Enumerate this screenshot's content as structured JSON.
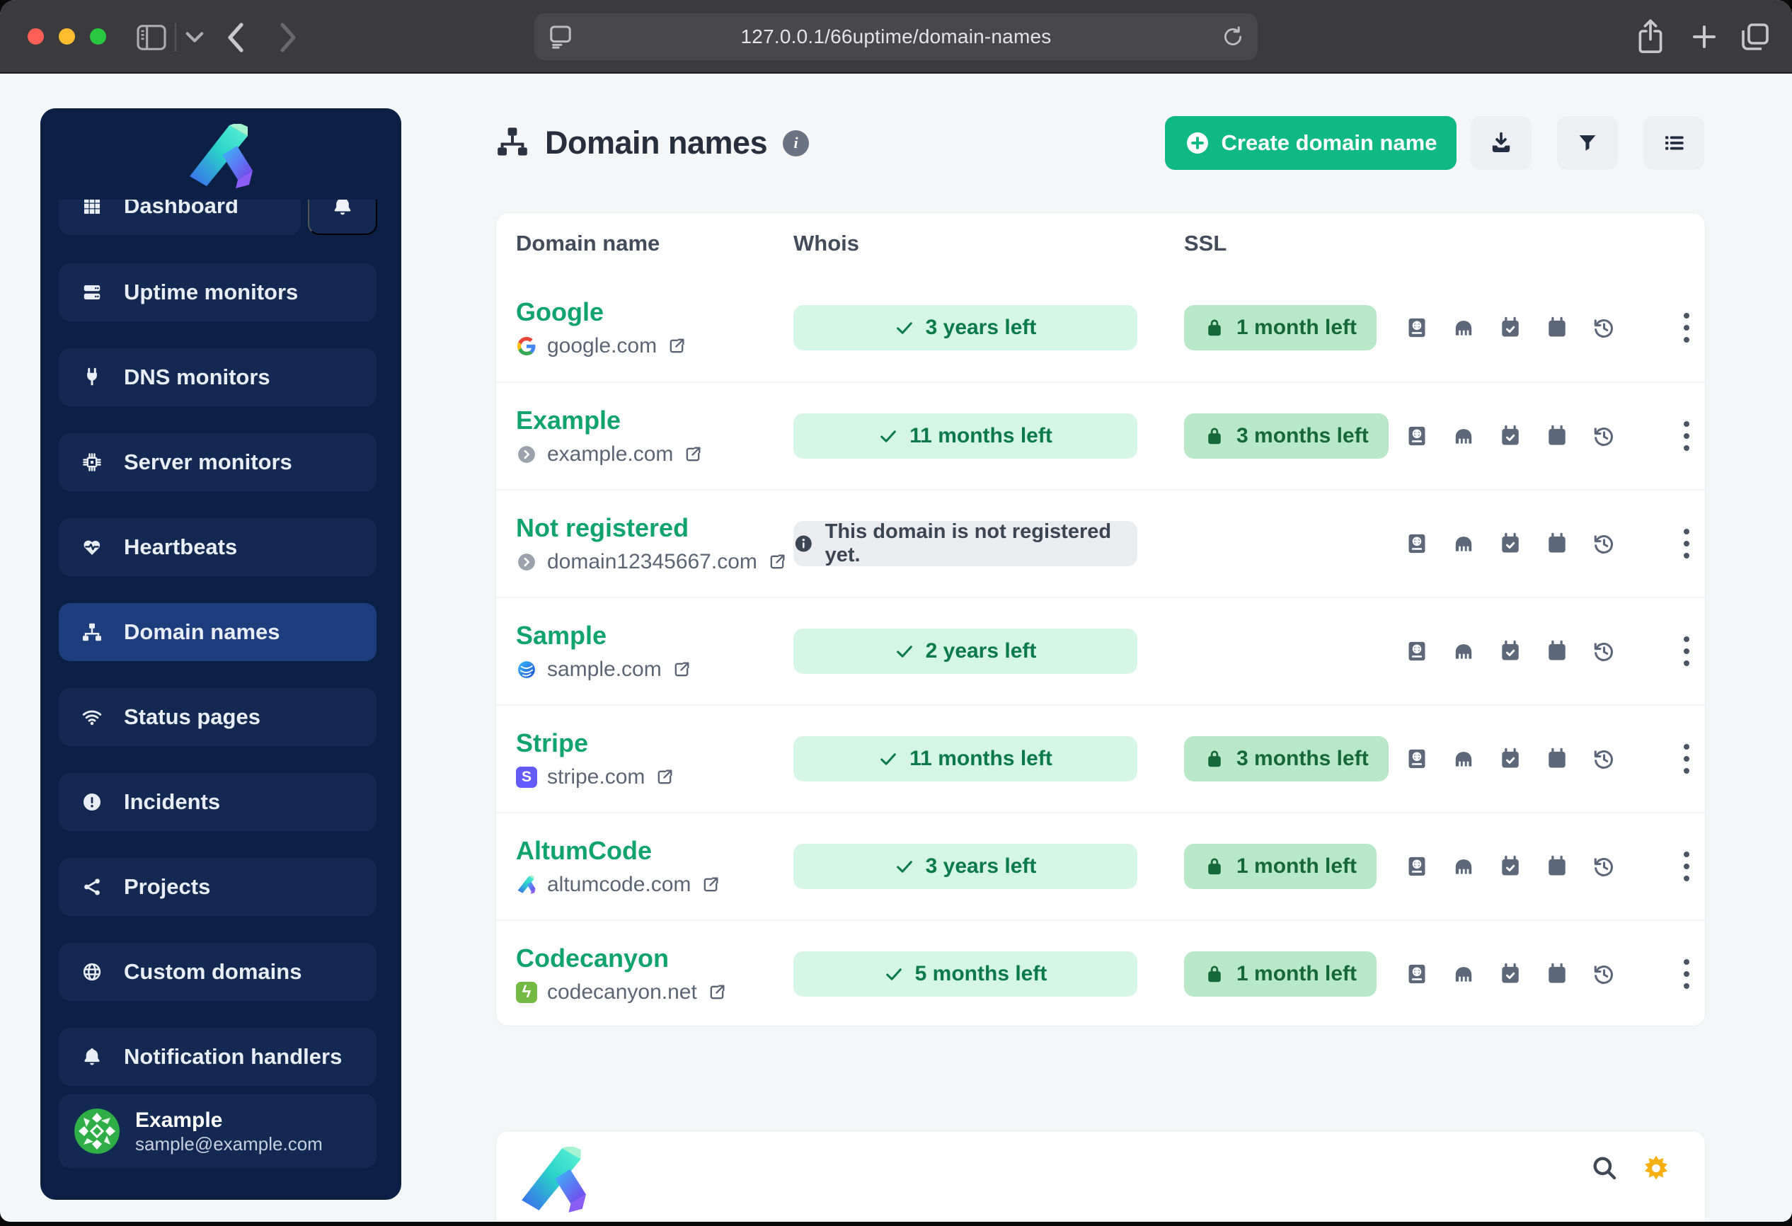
{
  "browser": {
    "url": "127.0.0.1/66uptime/domain-names"
  },
  "sidebar": {
    "items": [
      {
        "label": "Dashboard"
      },
      {
        "label": "Uptime monitors"
      },
      {
        "label": "DNS monitors"
      },
      {
        "label": "Server monitors"
      },
      {
        "label": "Heartbeats"
      },
      {
        "label": "Domain names"
      },
      {
        "label": "Status pages"
      },
      {
        "label": "Incidents"
      },
      {
        "label": "Projects"
      },
      {
        "label": "Custom domains"
      },
      {
        "label": "Notification handlers"
      }
    ],
    "active_item": "Domain names",
    "profile": {
      "name": "Example",
      "email": "sample@example.com"
    }
  },
  "page": {
    "title": "Domain names",
    "create_button": "Create domain name"
  },
  "table": {
    "columns": {
      "name": "Domain name",
      "whois": "Whois",
      "ssl": "SSL"
    },
    "rows": [
      {
        "name": "Google",
        "domain": "google.com",
        "whois": "3 years left",
        "ssl": "1 month left"
      },
      {
        "name": "Example",
        "domain": "example.com",
        "whois": "11 months left",
        "ssl": "3 months left"
      },
      {
        "name": "Not registered",
        "domain": "domain12345667.com",
        "whois": "This domain is not registered yet.",
        "ssl": ""
      },
      {
        "name": "Sample",
        "domain": "sample.com",
        "whois": "2 years left",
        "ssl": ""
      },
      {
        "name": "Stripe",
        "domain": "stripe.com",
        "whois": "11 months left",
        "ssl": "3 months left"
      },
      {
        "name": "AltumCode",
        "domain": "altumcode.com",
        "whois": "3 years left",
        "ssl": "1 month left"
      },
      {
        "name": "Codecanyon",
        "domain": "codecanyon.net",
        "whois": "5 months left",
        "ssl": "1 month left"
      }
    ]
  },
  "favicon_letters": {
    "stripe": "S",
    "codecanyon": "ϟ"
  },
  "colors": {
    "accent_green": "#10b981",
    "sidebar_navy": "#0c1f44",
    "sidebar_active": "#1d3d7c",
    "badge_ok_bg": "#d5f6e4",
    "badge_ok_text": "#0b7a4b",
    "badge_ssl_bg": "#b9e8c9",
    "badge_ssl_text": "#15683a",
    "badge_info_bg": "#eaecef",
    "badge_info_text": "#3c4554",
    "sun_icon": "#f7b011",
    "name_green": "#10a36e"
  }
}
